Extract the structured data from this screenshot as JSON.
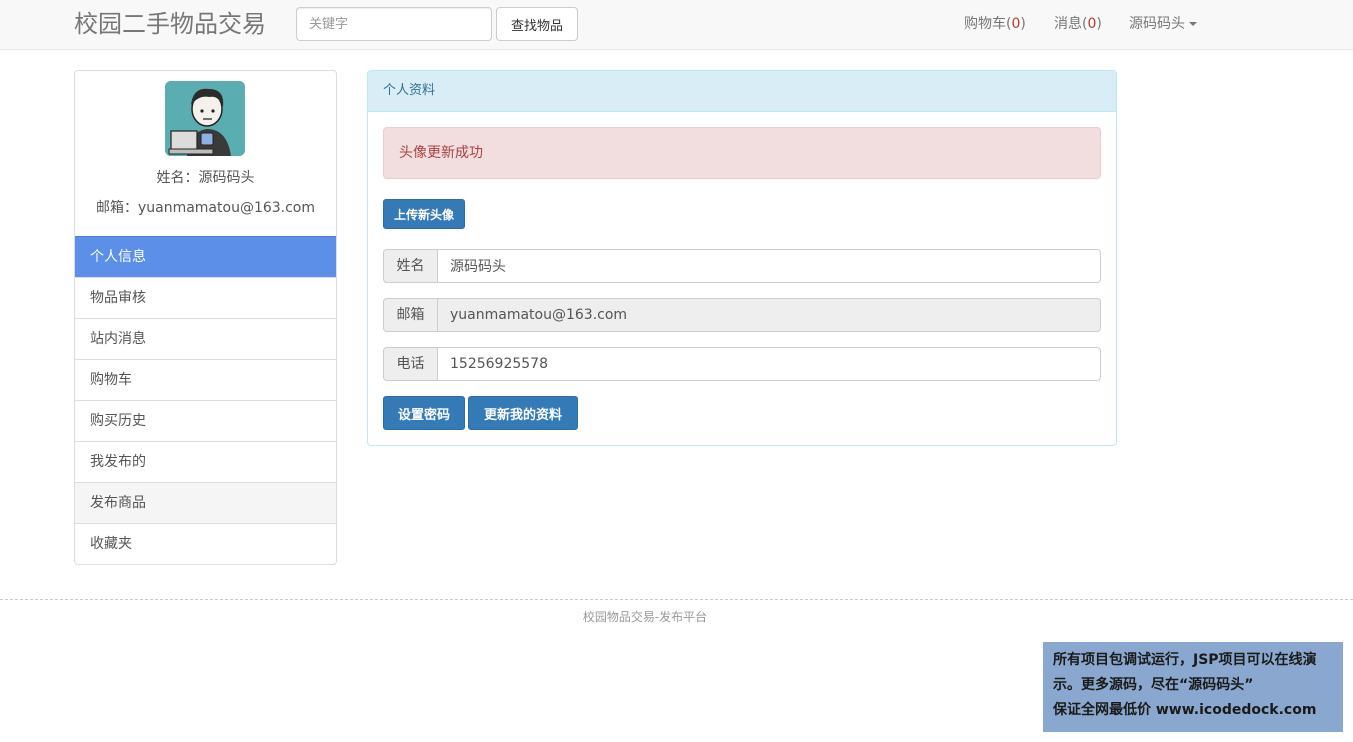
{
  "navbar": {
    "brand": "校园二手物品交易",
    "search_placeholder": "关键字",
    "search_button": "查找物品",
    "cart_label": "购物车(",
    "cart_count": "0",
    "message_label": "消息(",
    "message_count": "0",
    "paren_close": ")",
    "user_name": "源码码头"
  },
  "sidebar": {
    "name_line": "姓名：源码码头",
    "email_line": "邮箱：yuanmamatou@163.com",
    "menu": [
      {
        "label": "个人信息"
      },
      {
        "label": "物品审核"
      },
      {
        "label": "站内消息"
      },
      {
        "label": "购物车"
      },
      {
        "label": "购买历史"
      },
      {
        "label": "我发布的"
      },
      {
        "label": "发布商品"
      },
      {
        "label": "收藏夹"
      }
    ]
  },
  "panel": {
    "heading": "个人资料",
    "alert": "头像更新成功",
    "upload_button": "上传新头像",
    "fields": {
      "name": {
        "label": "姓名",
        "value": "源码码头"
      },
      "email": {
        "label": "邮箱",
        "value": "yuanmamatou@163.com"
      },
      "phone": {
        "label": "电话",
        "value": "15256925578"
      }
    },
    "password_button": "设置密码",
    "update_button": "更新我的资料"
  },
  "footer": {
    "text": "校园物品交易-发布平台"
  },
  "watermark": {
    "line1": "所有项目包调试运行，JSP项目可以在线演",
    "line2": "示。更多源码，尽在“源码码头”",
    "line3": "保证全网最低价 www.icodedock.com"
  },
  "colors": {
    "active_menu": "#5b8fe8",
    "primary": "#337ab7",
    "panel_heading": "#d9edf7",
    "alert_bg": "#f2dede",
    "badge_red": "#c0392b"
  }
}
